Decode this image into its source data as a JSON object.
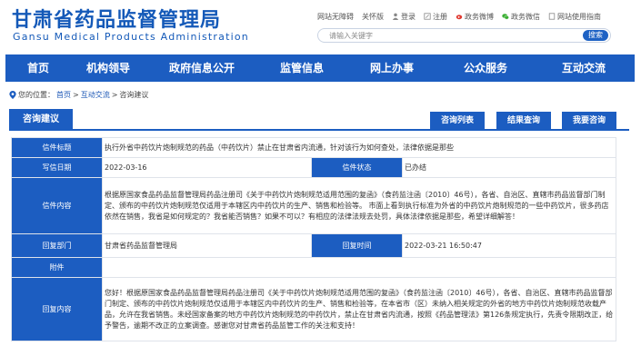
{
  "header": {
    "logo_cn": "甘肃省药品监督管理局",
    "logo_en": "Gansu Medical Products Administration",
    "toplinks": [
      "网站无障碍",
      "关怀版",
      "登录",
      "注册",
      "政务微博",
      "政务微信",
      "网站使用指南"
    ],
    "search_placeholder": "请输入关键字",
    "search_button": "搜索"
  },
  "nav": [
    "首页",
    "机构领导",
    "政府信息公开",
    "监管信息",
    "网上办事",
    "公众服务",
    "互动交流"
  ],
  "breadcrumb": {
    "prefix": "您的位置：",
    "home": "首页",
    "sep1": ">",
    "section": "互动交流",
    "sep2": ">",
    "current": "咨询建议"
  },
  "panel": {
    "title": "咨询建议",
    "buttons": [
      "咨询列表",
      "结果查询",
      "我要咨询"
    ]
  },
  "record": {
    "title_label": "信件标题",
    "title_value": "执行外省中药饮片炮制规范的药品（中药饮片）禁止在甘肃省内流通，针对该行为如何查处，法律依据是那些",
    "date_label": "写信日期",
    "date_value": "2022-03-16",
    "status_label": "信件状态",
    "status_value": "已办结",
    "content_label": "信件内容",
    "content_value": "根据原国家食品药品监督管理局药品注册司《关于中药饮片炮制规范适用范围的复函》（食药监注函〔2010〕46号），各省、自治区、直辖市药品监督部门制定、颁布的中药饮片炮制规范仅适用于本辖区内中药饮片的生产、销售和检验等。 市面上看到执行标准为外省的中药饮片炮制规范的一些中药饮片，很多药店依然在销售，我省是如何规定的？我省能否销售？如果不可以？有相应的法律法规去处罚，具体法律依据是那些，希望详细解答！",
    "dept_label": "回复部门",
    "dept_value": "甘肃省药品监督管理局",
    "reply_time_label": "回复时间",
    "reply_time_value": "2022-03-21 16:50:47",
    "attach_label": "附件",
    "attach_value": "",
    "reply_label": "回复内容",
    "reply_value": "您好！根据原国家食品药品监督管理局药品注册司《关于中药饮片炮制规范适用范围的复函》（食药监注函〔2010〕46号），各省、自治区、直辖市药品监督部门制定、颁布的中药饮片炮制规范仅适用于本辖区内中药饮片的生产、销售和检验等，在本省市（区）未纳入相关规定的外省的地方中药饮片炮制规范收载产品，允许在我省销售。未经国家备案的地方中药饮片炮制规范的中药饮片，禁止在甘肃省内流通，按照《药品管理法》第126条规定执行，先责令限期改正，给予警告，逾期不改正的立案调查。感谢您对甘肃省药品监管工作的关注和支持！"
  }
}
